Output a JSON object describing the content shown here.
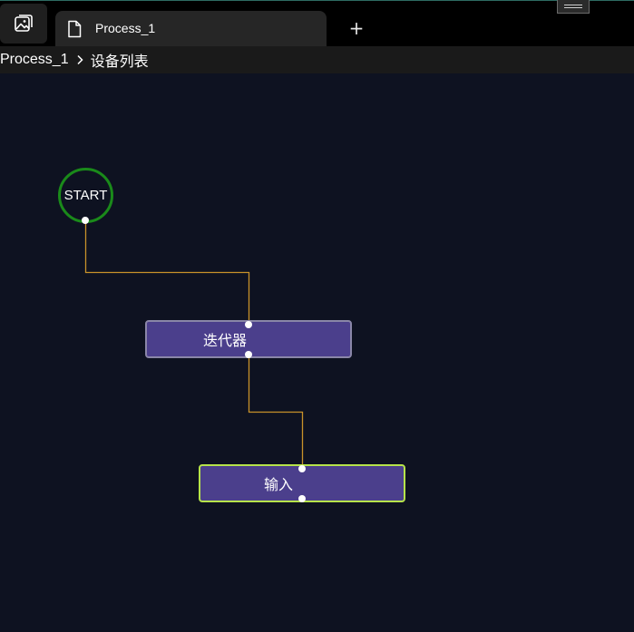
{
  "app": {
    "tab_label": "Process_1",
    "new_tab_label": "+"
  },
  "breadcrumb": {
    "items": [
      "Process_1",
      "设备列表"
    ]
  },
  "flow": {
    "start_label": "START",
    "nodes": [
      {
        "id": "iterator",
        "label": "迭代器",
        "state": "normal"
      },
      {
        "id": "input",
        "label": "输入",
        "state": "selected"
      }
    ]
  },
  "colors": {
    "canvas_bg": "#0e1221",
    "node_fill": "#4b3f8c",
    "start_ring": "#1a8a1a",
    "selected_border": "#b6e34a",
    "wire": "#c8922a"
  },
  "icons": {
    "app": "image-gallery-icon",
    "tab": "document-icon",
    "breadcrumb_separator": "chevron-right-icon"
  }
}
